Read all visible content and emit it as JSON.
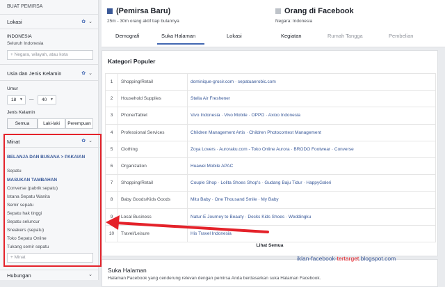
{
  "sidebar": {
    "title": "BUAT PEMIRSA",
    "lokasi": {
      "header": "Lokasi",
      "country": "INDONESIA",
      "scope": "Seluruh Indonesia",
      "input_placeholder": "+ Negara, wilayah, atau kota"
    },
    "usia": {
      "header": "Usia dan Jenis Kelamin",
      "age_label": "Umur",
      "age_min": "18",
      "age_max": "40",
      "age_dash": "—",
      "gender_label": "Jenis Kelamin",
      "gender_options": [
        "Semua",
        "Laki-laki",
        "Perempuan"
      ]
    },
    "minat": {
      "header": "Minat",
      "category1": "BELANJA DAN BUSANA > PAKAIAN",
      "item1": "Sepatu",
      "category2": "MASUKAN TAMBAHAN",
      "items": [
        "Converse (pabrik sepatu)",
        "Istana Sepatu Wanita",
        "Semir sepatu",
        "Sepatu hak tinggi",
        "Sepatu seluncur",
        "Sneakers (sepatu)",
        "Toko Sepatu Online",
        "Tukang semir sepatu"
      ],
      "input_placeholder": "+ Minat"
    },
    "hubungan": {
      "header": "Hubungan"
    }
  },
  "audience": {
    "left_title": "(Pemirsa Baru)",
    "left_sub": "25m - 30m orang aktif tiap bulannya",
    "right_title": "Orang di Facebook",
    "right_sub": "Negara: Indonesia",
    "left_color": "#3b5998",
    "right_color": "#bec3c9"
  },
  "tabs": [
    "Demografi",
    "Suka Halaman",
    "Lokasi",
    "Kegiatan",
    "Rumah Tangga",
    "Pembelian"
  ],
  "kategori": {
    "title": "Kategori Populer",
    "rows": [
      {
        "num": "1",
        "category": "Shopping/Retail",
        "pages": "dominique-grosir.com  ·  sepatuaerobic.com"
      },
      {
        "num": "2",
        "category": "Household Supplies",
        "pages": "Stella Air Freshener"
      },
      {
        "num": "3",
        "category": "Phone/Tablet",
        "pages": "Vivo Indonesia  ·  Vivo Mobile  ·  OPPO  ·  Axioo Indonesia"
      },
      {
        "num": "4",
        "category": "Professional Services",
        "pages": "Children Management Artis  ·  Children Photocontest Management"
      },
      {
        "num": "5",
        "category": "Clothing",
        "pages": "Zoya Lovers  ·  Auroraku.com - Toko Online Aurora  ·  BRODO Footwear  ·  Converse"
      },
      {
        "num": "6",
        "category": "Organization",
        "pages": "Huawei Mobile APAC"
      },
      {
        "num": "7",
        "category": "Shopping/Retail",
        "pages": "Couple Shop  ·  Lolita Shoes Shop's  ·  Gudang Baju Tidur  ·  HappyGaleri"
      },
      {
        "num": "8",
        "category": "Baby Goods/Kids Goods",
        "pages": "Mitu Baby  ·  One Thousand Smile  ·  My Baby"
      },
      {
        "num": "9",
        "category": "Local Business",
        "pages": "Natur-E Journey to Beauty  ·  Decks Kids Shoes  ·  Weddingku"
      },
      {
        "num": "10",
        "category": "Travel/Leisure",
        "pages": "His Travel Indonesia"
      }
    ],
    "see_all": "Lihat Semua"
  },
  "suka": {
    "title": "Suka Halaman",
    "subtitle": "Halaman Facebook yang cenderung relevan dengan pemirsa Anda berdasarkan suka Halaman Facebook."
  },
  "watermark": {
    "part1": "iklan-facebook-",
    "part2": "tertarget",
    "part3": ".blogspot.com"
  }
}
